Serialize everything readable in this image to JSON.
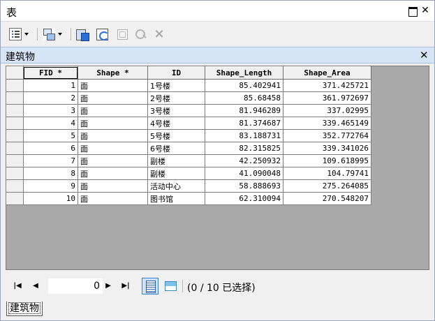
{
  "window": {
    "title": "表"
  },
  "toolbar": {
    "table_options": "table-options-icon",
    "related_tables": "related-tables-icon",
    "select_by_attributes": "select-by-attributes-icon",
    "switch_selection": "switch-selection-icon",
    "clear_selection": "clear-selection-icon",
    "zoom_to_selected": "zoom-to-selected-icon",
    "delete_selected": "×"
  },
  "tab": {
    "title": "建筑物"
  },
  "table": {
    "columns": [
      "FID *",
      "Shape *",
      "ID",
      "Shape_Length",
      "Shape_Area"
    ],
    "rows": [
      [
        "1",
        "面",
        "1号楼",
        "85.402941",
        "371.425721"
      ],
      [
        "2",
        "面",
        "2号楼",
        "85.68458",
        "361.972697"
      ],
      [
        "3",
        "面",
        "3号楼",
        "81.946289",
        "337.02995"
      ],
      [
        "4",
        "面",
        "4号楼",
        "81.374687",
        "339.465149"
      ],
      [
        "5",
        "面",
        "5号楼",
        "83.188731",
        "352.772764"
      ],
      [
        "6",
        "面",
        "6号楼",
        "82.315825",
        "339.341026"
      ],
      [
        "7",
        "面",
        "副楼",
        "42.250932",
        "109.618995"
      ],
      [
        "8",
        "面",
        "副楼",
        "41.090048",
        "104.79741"
      ],
      [
        "9",
        "面",
        "活动中心",
        "58.888693",
        "275.264085"
      ],
      [
        "10",
        "面",
        "图书馆",
        "62.310094",
        "270.548207"
      ]
    ]
  },
  "navigation": {
    "current_record": "0",
    "selection_status": "(0 / 10 已选择)"
  },
  "bottom_tab": {
    "label": "建筑物"
  }
}
